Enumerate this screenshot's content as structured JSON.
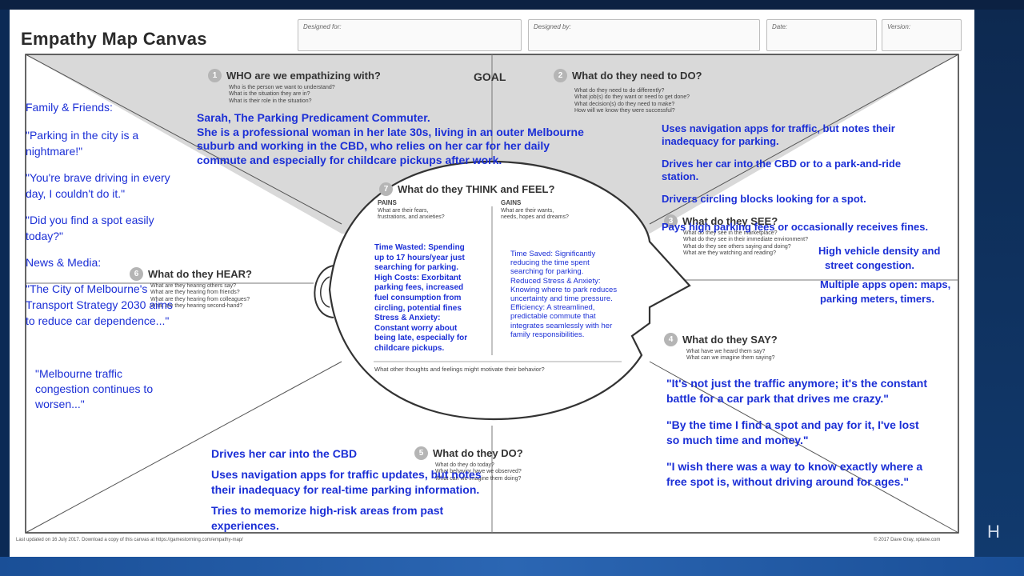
{
  "canvas_title": "Empathy Map Canvas",
  "header_fields": {
    "designed_for": "Designed for:",
    "designed_by": "Designed by:",
    "date": "Date:",
    "version": "Version:"
  },
  "goal": "GOAL",
  "q1": {
    "num": "1",
    "title": "WHO are we empathizing with?",
    "lines": [
      "Who is the person we want to understand?",
      "What is the situation they are in?",
      "What is their role in the situation?"
    ]
  },
  "q2": {
    "num": "2",
    "title": "What do they need to DO?",
    "lines": [
      "What do they need to do differently?",
      "What job(s) do they want or need to get done?",
      "What decision(s) do they need to make?",
      "How will we know they were successful?"
    ]
  },
  "q3": {
    "num": "3",
    "title": "What do they SEE?",
    "lines": [
      "What do they see in the marketplace?",
      "What do they see in their immediate environment?",
      "What do they see others saying and doing?",
      "What are they watching and reading?"
    ]
  },
  "q4": {
    "num": "4",
    "title": "What do they SAY?",
    "lines": [
      "What have we heard them say?",
      "What can we imagine them saying?"
    ]
  },
  "q5": {
    "num": "5",
    "title": "What do they DO?",
    "lines": [
      "What do they do today?",
      "What behavior have we observed?",
      "What can we imagine them doing?"
    ]
  },
  "q6": {
    "num": "6",
    "title": "What do they HEAR?",
    "lines": [
      "What are they hearing others say?",
      "What are they hearing from friends?",
      "What are they hearing from colleagues?",
      "What are they hearing second-hand?"
    ]
  },
  "q7": {
    "num": "7",
    "title": "What do they THINK and FEEL?",
    "pains_title": "PAINS",
    "pains_sub": [
      "What are their fears,",
      "frustrations, and anxieties?"
    ],
    "gains_title": "GAINS",
    "gains_sub": [
      "What are their wants,",
      "needs, hopes and dreams?"
    ],
    "bottom": "What other thoughts and feelings might motivate their behavior?"
  },
  "footer_left": "Last updated on 16 July 2017. Download a copy of this canvas at https://gamestorming.com/empathy-map/",
  "footer_right": "© 2017 Dave Gray, xplane.com",
  "persona": {
    "line1": "Sarah, The Parking Predicament Commuter.",
    "line2": "She is a professional woman in her late 30s, living in an outer Melbourne",
    "line3": "suburb and working in the CBD, who relies on her car for her daily",
    "line4": "commute and especially for childcare pickups after work."
  },
  "need_to_do": [
    "Uses navigation apps for traffic, but notes their",
    "inadequacy for parking.",
    "Drives her car into the CBD or to a park-and-ride",
    "station.",
    "Drivers circling blocks looking for a spot.",
    "Pays high parking fees or occasionally receives fines."
  ],
  "see": [
    "High vehicle density and",
    "street congestion.",
    "Multiple apps open: maps,",
    "parking meters, timers."
  ],
  "hear": {
    "family_label": "Family & Friends:",
    "family1": [
      "\"Parking in the city is a",
      "nightmare!\""
    ],
    "family2": [
      "\"You're brave driving in every",
      "day, I couldn't do it.\""
    ],
    "family3": [
      "\"Did you find a spot easily",
      "today?\""
    ],
    "media_label": "News & Media:",
    "media1": [
      "\"The City of Melbourne's",
      "Transport Strategy 2030 aims",
      "to reduce car dependence...\""
    ],
    "media2": [
      "\"Melbourne traffic",
      "congestion continues to",
      "worsen...\""
    ]
  },
  "pains": [
    "Time Wasted: Spending",
    "up to 17 hours/year just",
    "searching for parking.",
    "High Costs: Exorbitant",
    "parking fees, increased",
    "fuel consumption from",
    "circling, potential fines",
    "Stress & Anxiety:",
    "Constant worry about",
    "being late, especially for",
    "childcare pickups."
  ],
  "gains": [
    "Time Saved: Significantly",
    "reducing the time spent",
    "searching for parking.",
    "Reduced Stress & Anxiety:",
    "Knowing where to park reduces",
    "uncertainty and time pressure.",
    "Efficiency: A streamlined,",
    "predictable commute that",
    "integrates seamlessly with her",
    "family responsibilities."
  ],
  "say": [
    "\"It's not just the traffic anymore; it's the constant",
    "battle for a car park that drives me crazy.\"",
    "\"By the time I find a spot and pay for it, I've lost",
    "so much time and money.\"",
    "\"I wish there was a way to know exactly where a",
    "free spot is, without driving around for ages.\""
  ],
  "do": [
    "Drives her car into the CBD",
    "Uses navigation apps for traffic updates, but notes",
    "their inadequacy for real-time parking information.",
    "Tries to memorize high-risk areas from past",
    "experiences."
  ],
  "university_mark": "H"
}
